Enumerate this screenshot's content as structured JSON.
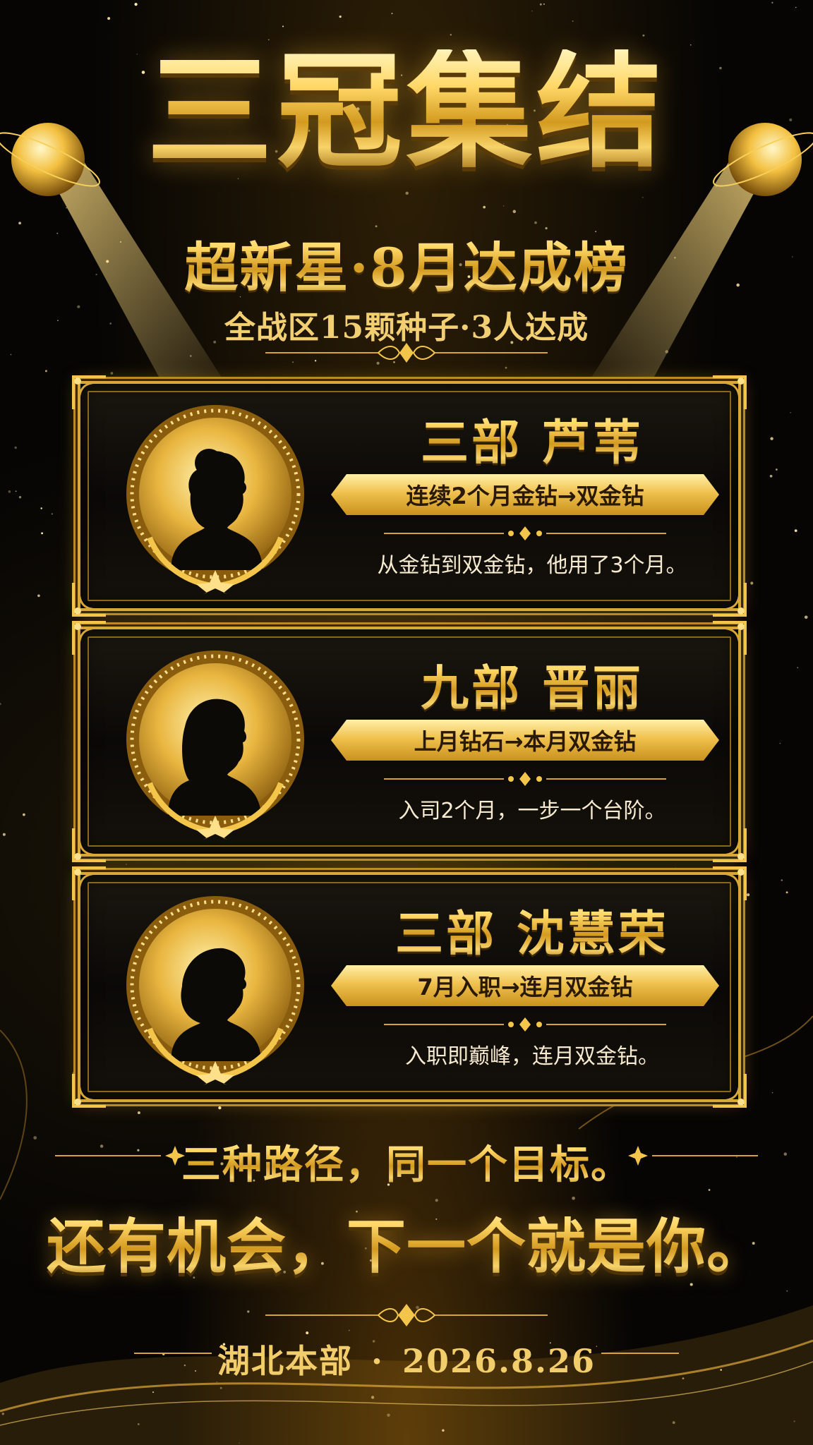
{
  "header": {
    "title": "三冠集结",
    "subtitle": "超新星·8月达成榜",
    "tagline": "全战区15颗种子·3人达成"
  },
  "cards": [
    {
      "name": "三部 芦苇",
      "achievement": "连续2个月金钻→双金钻",
      "quote": "从金钻到双金钻，他用了3个月。",
      "avatar_icon": "woman-bun-silhouette-icon"
    },
    {
      "name": "九部 晋丽",
      "achievement": "上月钻石→本月双金钻",
      "quote": "入司2个月，一步一个台阶。",
      "avatar_icon": "woman-long-hair-silhouette-icon"
    },
    {
      "name": "三部 沈慧荣",
      "achievement": "7月入职→连月双金钻",
      "quote": "入职即巅峰，连月双金钻。",
      "avatar_icon": "woman-bob-hair-silhouette-icon"
    }
  ],
  "closing": {
    "line1": "三种路径，同一个目标。",
    "line2": "还有机会，下一个就是你。"
  },
  "footer": {
    "org": "湖北本部",
    "separator": "·",
    "date": "2026.8.26"
  },
  "colors": {
    "background": "#060504",
    "gold": "#f3c64b",
    "gold_dark": "#9b6a10",
    "text_light": "#f6ead0"
  }
}
